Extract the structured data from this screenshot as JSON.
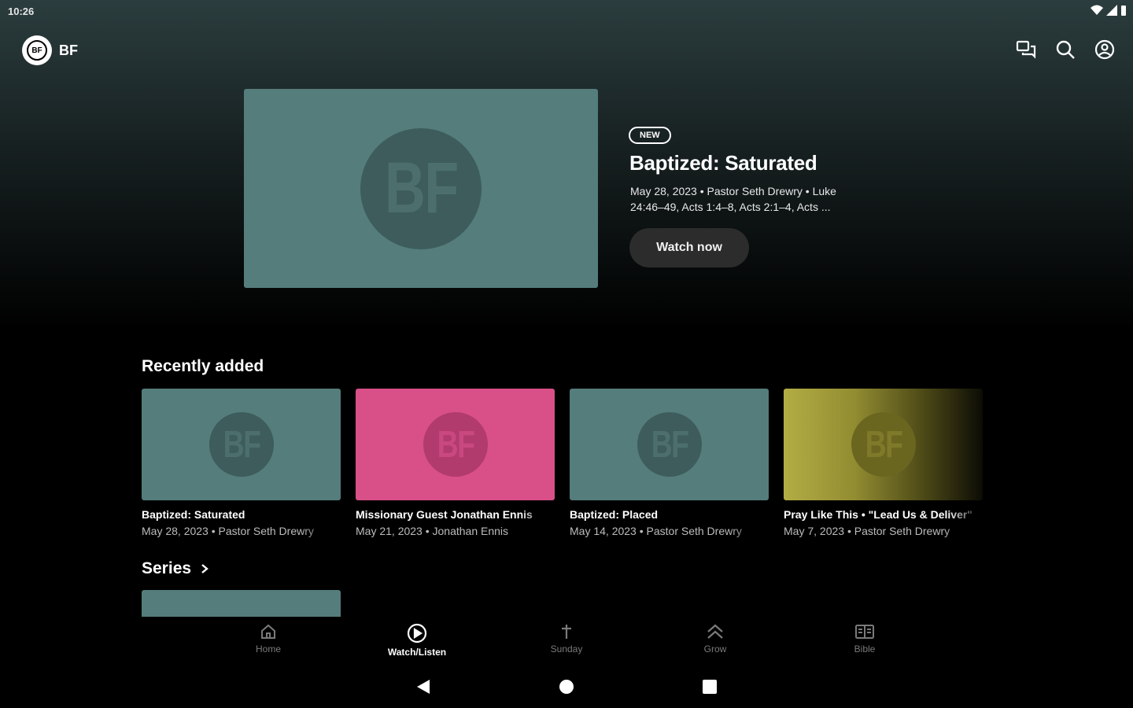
{
  "status_bar": {
    "time": "10:26"
  },
  "app": {
    "logo_text": "BF",
    "name": "BF"
  },
  "hero": {
    "badge": "NEW",
    "title": "Baptized: Saturated",
    "meta": "May 28, 2023 • Pastor Seth Drewry • Luke 24:46–49, Acts 1:4–8, Acts 2:1–4, Acts ...",
    "cta": "Watch now",
    "thumb_text": "BF",
    "thumb_color": "#547d7b"
  },
  "recently_added": {
    "title": "Recently added",
    "items": [
      {
        "title": "Baptized: Saturated",
        "meta": "May 28, 2023 • Pastor Seth Drewry",
        "thumb_text": "BF",
        "color": "#547d7b"
      },
      {
        "title": "Missionary Guest Jonathan Ennis",
        "meta": "May 21, 2023 • Jonathan Ennis",
        "thumb_text": "BF",
        "color": "#d94f88"
      },
      {
        "title": "Baptized: Placed",
        "meta": "May 14, 2023 • Pastor Seth Drewry",
        "thumb_text": "BF",
        "color": "#547d7b"
      },
      {
        "title": "Pray Like This • \"Lead Us & Deliver\"",
        "meta": "May 7, 2023 • Pastor Seth Drewry",
        "thumb_text": "BF",
        "color": "#b3ad45"
      }
    ]
  },
  "series": {
    "title": "Series"
  },
  "bottom_nav": {
    "items": [
      {
        "label": "Home",
        "icon": "home-icon",
        "active": false
      },
      {
        "label": "Watch/Listen",
        "icon": "play-circle-icon",
        "active": true
      },
      {
        "label": "Sunday",
        "icon": "cross-icon",
        "active": false
      },
      {
        "label": "Grow",
        "icon": "double-chevron-up-icon",
        "active": false
      },
      {
        "label": "Bible",
        "icon": "book-icon",
        "active": false
      }
    ]
  },
  "colors": {
    "accent_teal": "#547d7b",
    "accent_pink": "#d94f88",
    "accent_olive": "#b3ad45"
  }
}
